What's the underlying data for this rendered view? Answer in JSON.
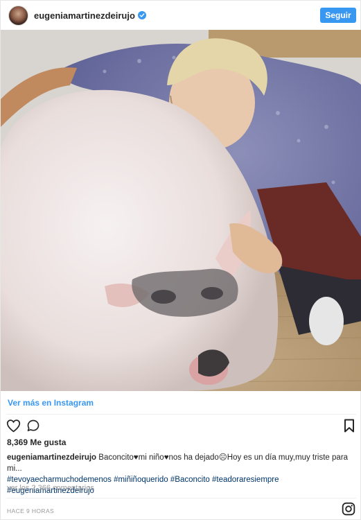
{
  "post": {
    "username": "eugeniamartinezdeirujo",
    "follow_label": "Seguir",
    "view_more_label": "Ver más en Instagram",
    "likes_text": "8,369 Me gusta",
    "caption_user": "eugeniamartinezdeirujo",
    "caption_text": " Baconcito♥mi niño♥nos ha dejado☹Hoy es un día muy,muy triste para mi...",
    "caption_tags_line1": "#tevoyaecharmuchodemenos #miñiñoquerido #Baconcito #teadoraresiempre",
    "caption_tags_line2": "#eugeniamartinezdeirujo",
    "comments_text": "ver los 2,366 comentarios",
    "time_text": "HACE 9 HORAS"
  },
  "colors": {
    "accent": "#3897f0",
    "hashtag": "#003569",
    "muted": "#999999",
    "text": "#262626"
  },
  "icons": {
    "verified": "verified-badge-icon",
    "like": "heart-outline-icon",
    "comment": "speech-bubble-icon",
    "save": "bookmark-icon",
    "instagram": "instagram-logo-icon"
  }
}
